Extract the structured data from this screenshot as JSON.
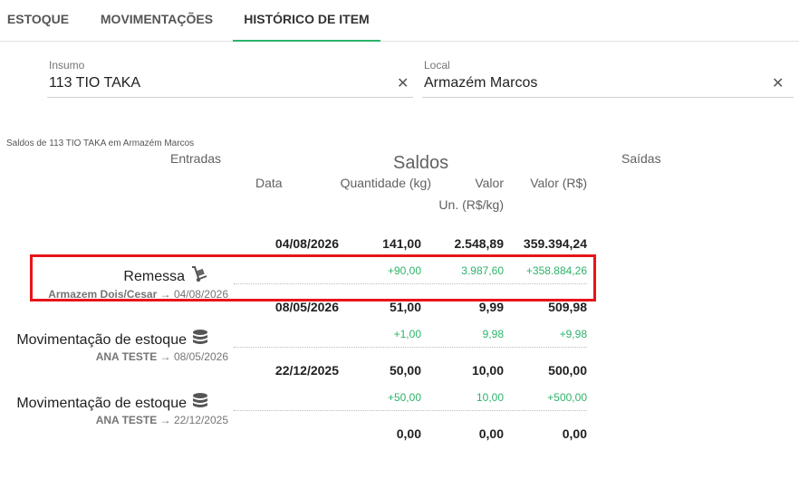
{
  "tabs": [
    {
      "label": "ESTOQUE",
      "active": false
    },
    {
      "label": "MOVIMENTAÇÕES",
      "active": false
    },
    {
      "label": "HISTÓRICO DE ITEM",
      "active": true
    }
  ],
  "filters": {
    "insumo": {
      "label": "Insumo",
      "value": "113 TIO TAKA"
    },
    "local": {
      "label": "Local",
      "value": "Armazém Marcos"
    }
  },
  "caption": "Saldos de 113 TIO TAKA em Armazém Marcos",
  "headers": {
    "entradas": "Entradas",
    "saldos": "Saldos",
    "saidas": "Saídas",
    "data": "Data",
    "quantidade": "Quantidade (kg)",
    "valor_un_1": "Valor",
    "valor_un_2": "Un. (R$/kg)",
    "valor_total": "Valor (R$)"
  },
  "balances": [
    {
      "date": "04/08/2026",
      "qty": "141,00",
      "unit": "2.548,89",
      "total": "359.394,24"
    },
    {
      "date": "08/05/2026",
      "qty": "51,00",
      "unit": "9,99",
      "total": "509,98"
    },
    {
      "date": "22/12/2025",
      "qty": "50,00",
      "unit": "10,00",
      "total": "500,00"
    },
    {
      "date": "",
      "qty": "0,00",
      "unit": "0,00",
      "total": "0,00"
    }
  ],
  "movements": [
    {
      "title": "Remessa",
      "icon": "hand-truck-icon",
      "who": "Armazem Dois/Cesar",
      "arrow": "→",
      "date": "04/08/2026",
      "qty": "+90,00",
      "unit": "3.987,60",
      "total": "+358.884,26"
    },
    {
      "title": "Movimentação de estoque",
      "icon": "database-icon",
      "who": "ANA TESTE",
      "arrow": "→",
      "date": "08/05/2026",
      "qty": "+1,00",
      "unit": "9,98",
      "total": "+9,98"
    },
    {
      "title": "Movimentação de estoque",
      "icon": "database-icon",
      "who": "ANA TESTE",
      "arrow": "→",
      "date": "22/12/2025",
      "qty": "+50,00",
      "unit": "10,00",
      "total": "+500,00"
    }
  ],
  "colors": {
    "accent": "#2db36a",
    "highlight": "#e8141a",
    "positive": "#2db36a"
  }
}
